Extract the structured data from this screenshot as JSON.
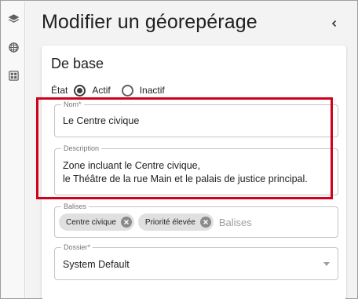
{
  "rail": {
    "icons": [
      "layers-icon",
      "grid-globe-icon",
      "dashboard-icon"
    ]
  },
  "header": {
    "title": "Modifier un géorepérage",
    "collapse_icon": "chevron-left-icon"
  },
  "section": {
    "title": "De base",
    "state_label": "État",
    "options": [
      {
        "label": "Actif",
        "checked": true
      },
      {
        "label": "Inactif",
        "checked": false
      }
    ]
  },
  "fields": {
    "name": {
      "label": "Nom*",
      "value": "Le Centre civique"
    },
    "description": {
      "label": "Description",
      "line1": "Zone incluant le Centre civique,",
      "line2": "le Théâtre de la rue Main et le palais de justice principal."
    },
    "tags": {
      "label": "Balises",
      "chips": [
        "Centre civique",
        "Priorité élevée"
      ],
      "placeholder": "Balises"
    },
    "folder": {
      "label": "Dossier*",
      "value": "System Default"
    }
  },
  "colors": {
    "highlight": "#d0021b",
    "chip_bg": "#e0e0e0"
  }
}
